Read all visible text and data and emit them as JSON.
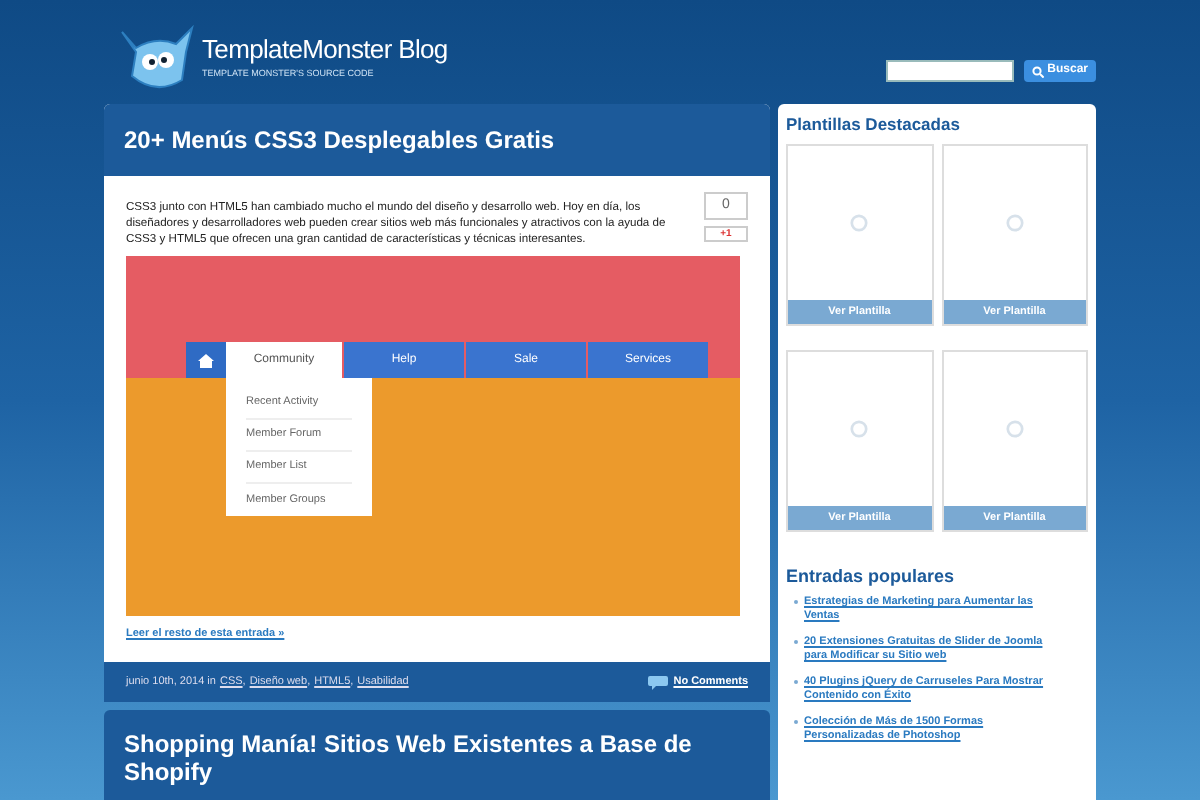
{
  "header": {
    "logo_title": "TemplateMonster Blog",
    "logo_subtitle": "TEMPLATE MONSTER'S SOURCE CODE",
    "search_button": "Buscar"
  },
  "posts": [
    {
      "title": "20+ Menús CSS3 Desplegables Gratis",
      "excerpt": "CSS3 junto con HTML5 han cambiado mucho el mundo del diseño y desarrollo web. Hoy en día, los diseñadores y desarrolladores web pueden crear sitios web más funcionales y atractivos con la ayuda de CSS3 y HTML5 que ofrecen una gran cantidad de características y técnicas interesantes.",
      "share_count": "0",
      "gplus": "+1",
      "demo_menu": {
        "tabs": [
          {
            "label": "Community",
            "selected": true
          },
          {
            "label": "Help",
            "selected": false
          },
          {
            "label": "Sale",
            "selected": false
          },
          {
            "label": "Services",
            "selected": false
          }
        ],
        "dropdown": [
          "Recent Activity",
          "Member Forum",
          "Member List",
          "Member Groups"
        ]
      },
      "read_more": "Leer el resto de esta entrada »",
      "meta_date": "junio 10th, 2014 in",
      "categories": [
        "CSS",
        "Diseño web",
        "HTML5",
        "Usabilidad"
      ],
      "category_separator": ",",
      "comments": "No Comments"
    },
    {
      "title": "Shopping Manía! Sitios Web Existentes a Base de Shopify"
    }
  ],
  "sidebar": {
    "featured_title": "Plantillas Destacadas",
    "featured": [
      {
        "button": "Ver Plantilla"
      },
      {
        "button": "Ver Plantilla"
      },
      {
        "button": "Ver Plantilla"
      },
      {
        "button": "Ver Plantilla"
      }
    ],
    "popular_title": "Entradas populares",
    "popular": [
      "Estrategias de Marketing para Aumentar las Ventas",
      "20 Extensiones Gratuitas de Slider de Joomla para Modificar su Sitio web",
      "40 Plugins jQuery de Carruseles Para Mostrar Contenido con Éxito",
      "Colección de Más de 1500 Formas Personalizadas de Photoshop"
    ]
  }
}
